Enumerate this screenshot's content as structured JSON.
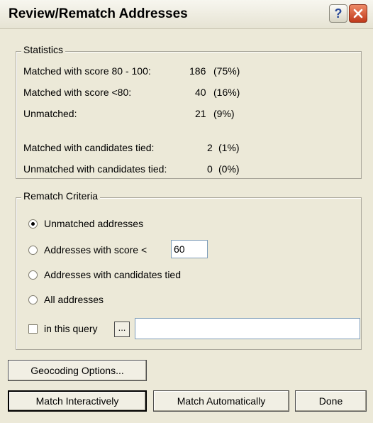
{
  "window": {
    "title": "Review/Rematch Addresses",
    "help_label": "?"
  },
  "statistics": {
    "legend": "Statistics",
    "rows": [
      {
        "label": "Matched with score 80 - 100:",
        "count": "186",
        "percent": "(75%)"
      },
      {
        "label": "Matched with score <80:",
        "count": "40",
        "percent": "(16%)"
      },
      {
        "label": "Unmatched:",
        "count": "21",
        "percent": "(9%)"
      },
      {
        "label": "Matched with candidates tied:",
        "count": "2",
        "percent": "(1%)"
      },
      {
        "label": "Unmatched with candidates tied:",
        "count": "0",
        "percent": "(0%)"
      }
    ]
  },
  "rematch": {
    "legend": "Rematch Criteria",
    "options": [
      {
        "label": "Unmatched addresses",
        "checked": true
      },
      {
        "label": "Addresses with score <",
        "checked": false
      },
      {
        "label": "Addresses with candidates tied",
        "checked": false
      },
      {
        "label": "All addresses",
        "checked": false
      }
    ],
    "score_value": "60",
    "query_label": "in this query",
    "query_checked": false,
    "query_button": "...",
    "query_value": ""
  },
  "buttons": {
    "geocoding_options": "Geocoding Options...",
    "match_interactively": "Match Interactively",
    "match_automatically": "Match Automatically",
    "done": "Done"
  }
}
